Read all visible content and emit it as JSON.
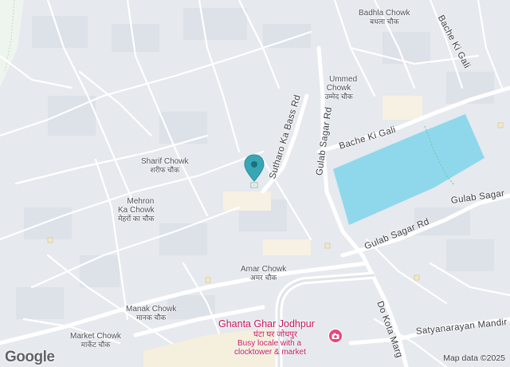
{
  "map": {
    "labels": [
      {
        "id": "badhla",
        "en": "Badhla Chowk",
        "hi": "बधला चौक"
      },
      {
        "id": "ummed",
        "en": "Ummed\nChowk",
        "hi": "उम्मेद चौक"
      },
      {
        "id": "sharif",
        "en": "Sharif Chowk",
        "hi": "शरीफ चौक"
      },
      {
        "id": "mehron",
        "en": "Mehron\nKa Chowk",
        "hi": "मेहरों का चौक"
      },
      {
        "id": "amar",
        "en": "Amar Chowk",
        "hi": "अमर चौक"
      },
      {
        "id": "manak",
        "en": "Manak Chowk",
        "hi": "मानक चौक"
      },
      {
        "id": "market",
        "en": "Market Chowk",
        "hi": "मार्केट चौक"
      }
    ],
    "roads": {
      "bache_ki_gali_ne": "Bache Ki Gali",
      "bache_ki_gali": "Bache Ki Gali",
      "sutharo": "Sutharo Ka Bass Rd",
      "gulab_sagar_rd_v": "Gulab Sagar Rd",
      "gulab_sagar_rd_h": "Gulab Sagar Rd",
      "gulab_sagar_e": "Gulab Sagar",
      "do_kota_marg": "Do Kota Marg",
      "satyanarayan": "Satyanarayan Mandir"
    },
    "poi": {
      "title": "Ghanta Ghar Jodhpur",
      "hindi": "घंटा घर जोधपुर",
      "desc1": "Busy locale with a",
      "desc2": "clocktower & market"
    },
    "water_color": "#8fd8ec",
    "pin_color": "#38a6b5",
    "attribution": "Map data ©2025",
    "logo": "Google"
  }
}
